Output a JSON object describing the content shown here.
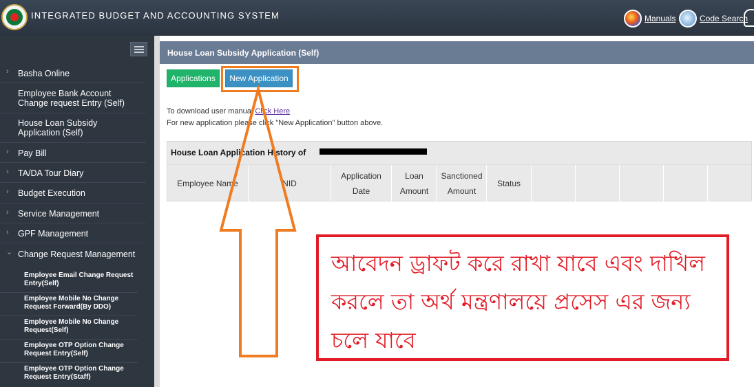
{
  "header": {
    "app_title": "INTEGRATED BUDGET AND ACCOUNTING SYSTEM",
    "manuals_label": "Manuals",
    "code_search_label": "Code Search"
  },
  "sidebar": {
    "items": [
      {
        "label": "Basha Online",
        "chevron": "›"
      },
      {
        "label": "Employee Bank Account Change request Entry (Self)",
        "chevron": ""
      },
      {
        "label": "House Loan Subsidy Application (Self)",
        "chevron": ""
      },
      {
        "label": "Pay Bill",
        "chevron": "›"
      },
      {
        "label": "TA/DA Tour Diary",
        "chevron": "›"
      },
      {
        "label": "Budget Execution",
        "chevron": "›"
      },
      {
        "label": "Service Management",
        "chevron": "›"
      },
      {
        "label": "GPF Management",
        "chevron": "›"
      },
      {
        "label": "Change Request Management",
        "chevron": "⌄"
      }
    ],
    "sub_items": [
      {
        "label": "Employee Email Change Request Entry(Self)"
      },
      {
        "label": "Employee Mobile No Change Request Forward(By DDO)"
      },
      {
        "label": "Employee Mobile No Change Request(Self)"
      },
      {
        "label": "Employee OTP Option Change Request Entry(Self)"
      },
      {
        "label": "Employee OTP Option Change Request Entry(Staff)"
      }
    ]
  },
  "main": {
    "title": "House Loan Subsidy Application (Self)",
    "applications_button": "Applications",
    "new_application_button": "New Application",
    "manual_text": "To download user manual",
    "manual_link": "Click Here",
    "instruction_text": "For new application please click \"New Application\" button above.",
    "history_title": "House Loan Application History of",
    "table_headers": [
      [
        "Employee Name"
      ],
      [
        "NID"
      ],
      [
        "Application",
        "Date"
      ],
      [
        "Loan",
        "Amount"
      ],
      [
        "Sanctioned",
        "Amount"
      ],
      [
        "Status"
      ],
      [
        ""
      ],
      [
        ""
      ],
      [
        ""
      ],
      [
        ""
      ],
      [
        ""
      ]
    ]
  },
  "annotation": {
    "note_text": "আবেদন ড্রাফট করে রাখা যাবে এবং দাখিল করলে তা অর্থ মন্ত্রণালয়ে প্রসেস এর জন্য চলে যাবে",
    "accent_orange": "#f07c22",
    "accent_red": "#e21c26"
  }
}
